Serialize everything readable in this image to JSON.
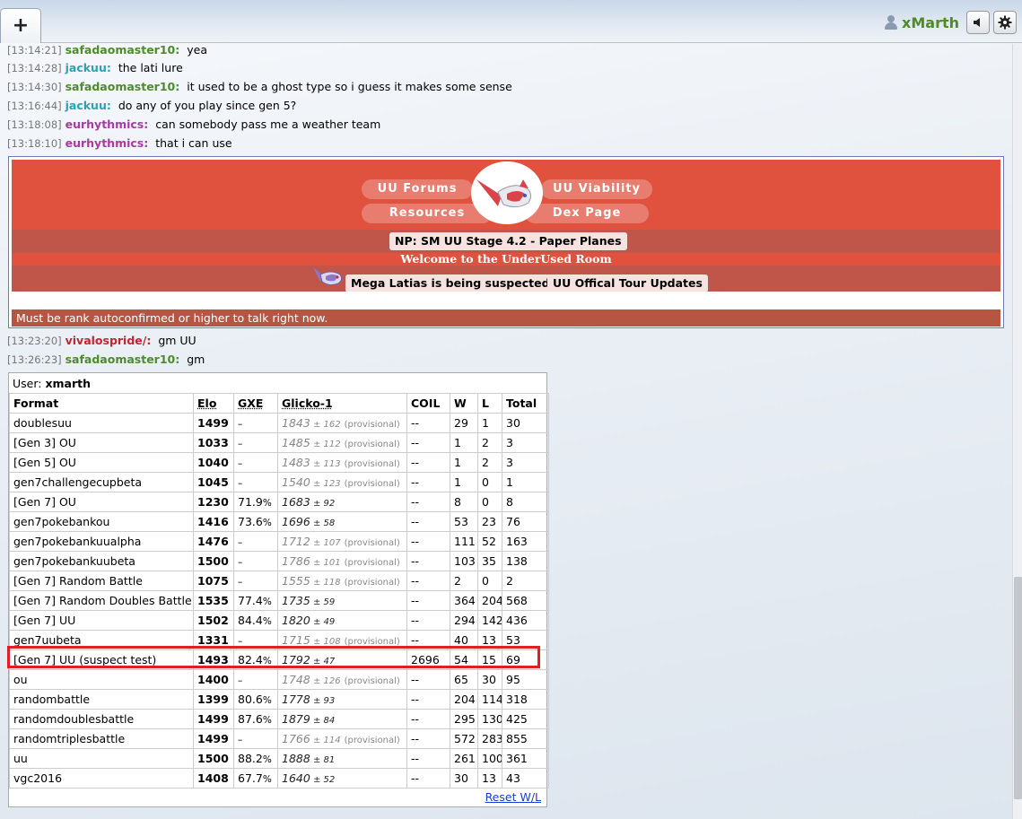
{
  "header": {
    "new_tab_label": "+",
    "username": "xMarth"
  },
  "messages": [
    {
      "time": "[13:14:21]",
      "nick": "safadaomaster10:",
      "text": "yea",
      "color": "#4b8c2b"
    },
    {
      "time": "[13:14:28]",
      "nick": "jackuu:",
      "text": "the lati lure",
      "color": "#2aa3b4"
    },
    {
      "time": "[13:14:30]",
      "nick": "safadaomaster10:",
      "text": "it used to be a ghost type so i guess it makes some sense",
      "color": "#4b8c2b"
    },
    {
      "time": "[13:16:44]",
      "nick": "jackuu:",
      "text": "do any of you play since gen 5?",
      "color": "#2aa3b4"
    },
    {
      "time": "[13:18:08]",
      "nick": "eurhythmics:",
      "text": "can somebody pass me a weather team",
      "color": "#a83aa3"
    },
    {
      "time": "[13:18:10]",
      "nick": "eurhythmics:",
      "text": "that i can use",
      "color": "#a83aa3"
    },
    {
      "time": "[13:23:20]",
      "nick": "vivalospride/:",
      "text": "gm UU",
      "color": "#c0262d"
    },
    {
      "time": "[13:26:23]",
      "nick": "safadaomaster10:",
      "text": "gm",
      "color": "#4b8c2b"
    }
  ],
  "intro": {
    "links": [
      "UU Forums",
      "UU Viability",
      "Resources",
      "Dex Page"
    ],
    "np": "NP: SM UU Stage 4.2 - Paper Planes",
    "welcome": "Welcome to the UnderUsed Room",
    "suspect": "Mega Latias is being suspected!",
    "tour": "UU Offical Tour Updates",
    "rank_warning": "Must be rank autoconfirmed or higher to talk right now."
  },
  "rankings": {
    "user_label": "User:",
    "user_name": "xmarth",
    "headers": [
      "Format",
      "Elo",
      "GXE",
      "Glicko-1",
      "COIL",
      "W",
      "L",
      "Total"
    ],
    "provisional_label": "(provisional)",
    "rows": [
      {
        "format": "doublesuu",
        "elo": "1499",
        "gxe": "–",
        "glicko": "1843",
        "dev": "162",
        "prov": true,
        "coil": "--",
        "w": "29",
        "l": "1",
        "total": "30"
      },
      {
        "format": "[Gen 3] OU",
        "elo": "1033",
        "gxe": "–",
        "glicko": "1485",
        "dev": "112",
        "prov": true,
        "coil": "--",
        "w": "1",
        "l": "2",
        "total": "3"
      },
      {
        "format": "[Gen 5] OU",
        "elo": "1040",
        "gxe": "–",
        "glicko": "1483",
        "dev": "113",
        "prov": true,
        "coil": "--",
        "w": "1",
        "l": "2",
        "total": "3"
      },
      {
        "format": "gen7challengecupbeta",
        "elo": "1045",
        "gxe": "–",
        "glicko": "1540",
        "dev": "123",
        "prov": true,
        "coil": "--",
        "w": "1",
        "l": "0",
        "total": "1"
      },
      {
        "format": "[Gen 7] OU",
        "elo": "1230",
        "gxe": "71.9%",
        "glicko": "1683",
        "dev": "92",
        "prov": false,
        "coil": "--",
        "w": "8",
        "l": "0",
        "total": "8"
      },
      {
        "format": "gen7pokebankou",
        "elo": "1416",
        "gxe": "73.6%",
        "glicko": "1696",
        "dev": "58",
        "prov": false,
        "coil": "--",
        "w": "53",
        "l": "23",
        "total": "76"
      },
      {
        "format": "gen7pokebankuualpha",
        "elo": "1476",
        "gxe": "–",
        "glicko": "1712",
        "dev": "107",
        "prov": true,
        "coil": "--",
        "w": "111",
        "l": "52",
        "total": "163"
      },
      {
        "format": "gen7pokebankuubeta",
        "elo": "1500",
        "gxe": "–",
        "glicko": "1786",
        "dev": "101",
        "prov": true,
        "coil": "--",
        "w": "103",
        "l": "35",
        "total": "138"
      },
      {
        "format": "[Gen 7] Random Battle",
        "elo": "1075",
        "gxe": "–",
        "glicko": "1555",
        "dev": "118",
        "prov": true,
        "coil": "--",
        "w": "2",
        "l": "0",
        "total": "2"
      },
      {
        "format": "[Gen 7] Random Doubles Battle",
        "elo": "1535",
        "gxe": "77.4%",
        "glicko": "1735",
        "dev": "59",
        "prov": false,
        "coil": "--",
        "w": "364",
        "l": "204",
        "total": "568"
      },
      {
        "format": "[Gen 7] UU",
        "elo": "1502",
        "gxe": "84.4%",
        "glicko": "1820",
        "dev": "49",
        "prov": false,
        "coil": "--",
        "w": "294",
        "l": "142",
        "total": "436"
      },
      {
        "format": "gen7uubeta",
        "elo": "1331",
        "gxe": "–",
        "glicko": "1715",
        "dev": "108",
        "prov": true,
        "coil": "--",
        "w": "40",
        "l": "13",
        "total": "53"
      },
      {
        "format": "[Gen 7] UU (suspect test)",
        "elo": "1493",
        "gxe": "82.4%",
        "glicko": "1792",
        "dev": "47",
        "prov": false,
        "coil": "2696",
        "w": "54",
        "l": "15",
        "total": "69"
      },
      {
        "format": "ou",
        "elo": "1400",
        "gxe": "–",
        "glicko": "1748",
        "dev": "126",
        "prov": true,
        "coil": "--",
        "w": "65",
        "l": "30",
        "total": "95"
      },
      {
        "format": "randombattle",
        "elo": "1399",
        "gxe": "80.6%",
        "glicko": "1778",
        "dev": "93",
        "prov": false,
        "coil": "--",
        "w": "204",
        "l": "114",
        "total": "318"
      },
      {
        "format": "randomdoublesbattle",
        "elo": "1499",
        "gxe": "87.6%",
        "glicko": "1879",
        "dev": "84",
        "prov": false,
        "coil": "--",
        "w": "295",
        "l": "130",
        "total": "425"
      },
      {
        "format": "randomtriplesbattle",
        "elo": "1499",
        "gxe": "–",
        "glicko": "1766",
        "dev": "114",
        "prov": true,
        "coil": "--",
        "w": "572",
        "l": "283",
        "total": "855"
      },
      {
        "format": "uu",
        "elo": "1500",
        "gxe": "88.2%",
        "glicko": "1888",
        "dev": "81",
        "prov": false,
        "coil": "--",
        "w": "261",
        "l": "100",
        "total": "361"
      },
      {
        "format": "vgc2016",
        "elo": "1408",
        "gxe": "67.7%",
        "glicko": "1640",
        "dev": "52",
        "prov": false,
        "coil": "--",
        "w": "30",
        "l": "13",
        "total": "43"
      }
    ],
    "reset_label": "Reset W/L"
  },
  "colors": {
    "banner": "#e0513e",
    "band": "#c0554a",
    "highlight": "#e01e26",
    "username": "#4f8b28"
  }
}
